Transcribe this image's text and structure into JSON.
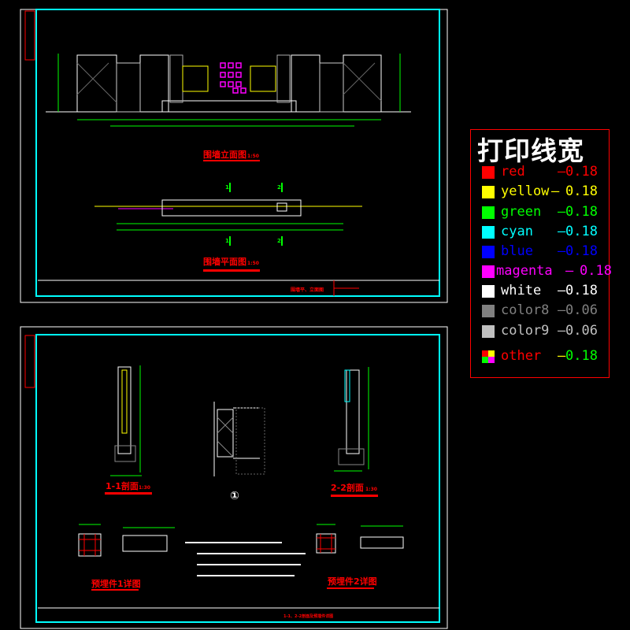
{
  "sheet1": {
    "elevation_title": "围墙立面图",
    "elevation_scale": "1:50",
    "plan_title": "围墙平面图",
    "plan_scale": "1:50",
    "section_mark_1": "1",
    "section_mark_2": "2",
    "titleblock_name": "围墙平、立面图"
  },
  "sheet2": {
    "section1_title": "1-1剖面",
    "section1_scale": "1:30",
    "section2_title": "2-2剖面",
    "section2_scale": "1:30",
    "detail_mark": "①",
    "embed1_title": "预埋件1详图",
    "embed2_title": "预埋件2详图",
    "titleblock_name": "1-1、2-2剖面及预埋件详图"
  },
  "legend": {
    "title": "打印线宽",
    "items": [
      {
        "name": "red",
        "dash": "—",
        "value": "0.18",
        "color": "#ff0000",
        "text_color": "#ff0000",
        "value_color": "#ff0000"
      },
      {
        "name": "yellow",
        "dash": "—",
        "value": "0.18",
        "color": "#ffff00",
        "text_color": "#ffff00",
        "value_color": "#ffff00"
      },
      {
        "name": "green",
        "dash": "—",
        "value": "0.18",
        "color": "#00ff00",
        "text_color": "#00ff00",
        "value_color": "#00ff00"
      },
      {
        "name": "cyan",
        "dash": "—",
        "value": "0.18",
        "color": "#00ffff",
        "text_color": "#00ffff",
        "value_color": "#00ffff"
      },
      {
        "name": "blue",
        "dash": "—",
        "value": "0.18",
        "color": "#0000ff",
        "text_color": "#0000ff",
        "value_color": "#0000ff"
      },
      {
        "name": "magenta",
        "dash": "—",
        "value": "0.18",
        "color": "#ff00ff",
        "text_color": "#ff00ff",
        "value_color": "#ff00ff"
      },
      {
        "name": "white",
        "dash": "—",
        "value": "0.18",
        "color": "#ffffff",
        "text_color": "#ffffff",
        "value_color": "#ffffff"
      },
      {
        "name": "color8",
        "dash": "—",
        "value": "0.06",
        "color": "#808080",
        "text_color": "#808080",
        "value_color": "#808080"
      },
      {
        "name": "color9",
        "dash": "—",
        "value": "0.06",
        "color": "#c0c0c0",
        "text_color": "#c0c0c0",
        "value_color": "#c0c0c0"
      },
      {
        "name": "other",
        "dash": "—",
        "value": "0.18",
        "color": "multi",
        "text_color": "#ff0000",
        "value_color": "#00ff00"
      }
    ]
  }
}
